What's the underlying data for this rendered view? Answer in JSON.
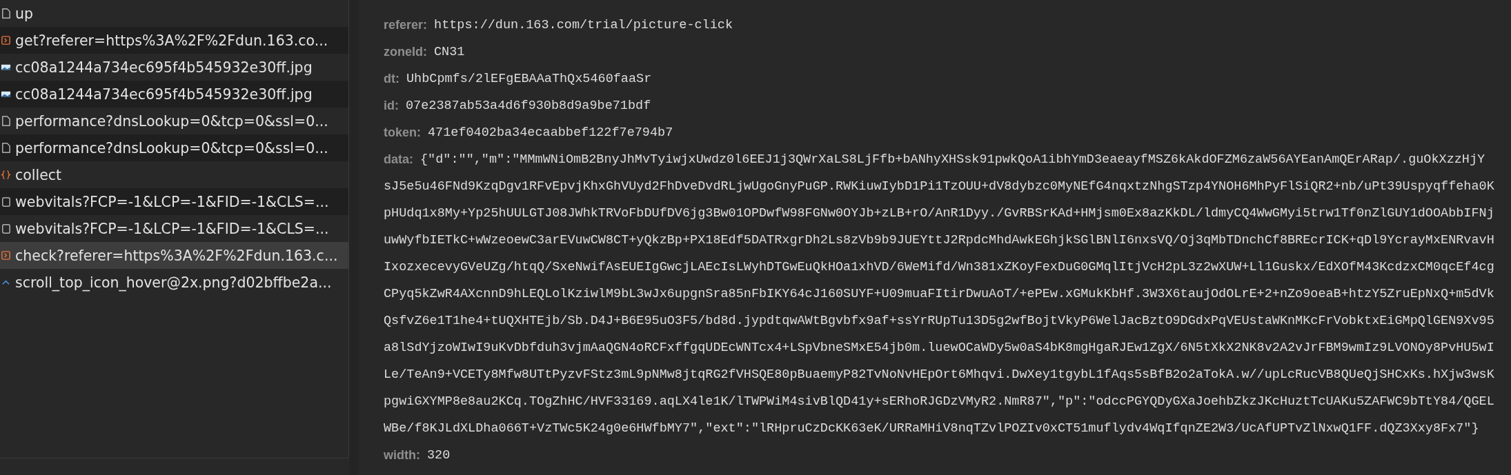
{
  "requests": [
    {
      "name": "up",
      "kind": "document",
      "selected": false
    },
    {
      "name": "get?referer=https%3A%2F%2Fdun.163.co...",
      "kind": "xhr",
      "selected": false
    },
    {
      "name": "cc08a1244a734ec695f4b545932e30ff.jpg",
      "kind": "image",
      "selected": false
    },
    {
      "name": "cc08a1244a734ec695f4b545932e30ff.jpg",
      "kind": "image",
      "selected": false
    },
    {
      "name": "performance?dnsLookup=0&tcp=0&ssl=0...",
      "kind": "document",
      "selected": false
    },
    {
      "name": "performance?dnsLookup=0&tcp=0&ssl=0...",
      "kind": "document",
      "selected": false
    },
    {
      "name": "collect",
      "kind": "fetch",
      "selected": false
    },
    {
      "name": "webvitals?FCP=-1&LCP=-1&FID=-1&CLS=...",
      "kind": "other",
      "selected": false
    },
    {
      "name": "webvitals?FCP=-1&LCP=-1&FID=-1&CLS=...",
      "kind": "other",
      "selected": false
    },
    {
      "name": "check?referer=https%3A%2F%2Fdun.163.c...",
      "kind": "xhr",
      "selected": true
    },
    {
      "name": "scroll_top_icon_hover@2x.png?d02bffbe2a...",
      "kind": "arrow",
      "selected": false
    }
  ],
  "params": [
    {
      "key": "referer:",
      "lines": [
        "https://dun.163.com/trial/picture-click"
      ]
    },
    {
      "key": "zoneId:",
      "lines": [
        "CN31"
      ]
    },
    {
      "key": "dt:",
      "lines": [
        "UhbCpmfs/2lEFgEBAAaThQx5460faaSr"
      ]
    },
    {
      "key": "id:",
      "lines": [
        "07e2387ab53a4d6f930b8d9a9be71bdf"
      ]
    },
    {
      "key": "token:",
      "lines": [
        "471ef0402ba34ecaabbef122f7e794b7"
      ]
    },
    {
      "key": "data:",
      "lines": [
        "{\"d\":\"\",\"m\":\"MMmWNiOmB2BnyJhMvTyiwjxUwdz0l6EEJ1j3QWrXaLS8LjFfb+bANhyXHSsk91pwkQoA1ibhYmD3eaeayfMSZ6kAkdOFZM6zaW56AYEanAmQErARap/.guOkXzzHjY",
        "sJ5e5u46FNd9KzqDgv1RFvEpvjKhxGhVUyd2FhDveDvdRLjwUgoGnyPuGP.RWKiuwIybD1Pi1TzOUU+dV8dybzc0MyNEfG4nqxtzNhgSTzp4YNOH6MhPyFlSiQR2+nb/uPt39Uspyqffeha0K",
        "pHUdq1x8My+Yp25hUULGTJ08JWhkTRVoFbDUfDV6jg3Bw01OPDwfW98FGNw0OYJb+zLB+rO/AnR1Dyy./GvRBSrKAd+HMjsm0Ex8azKkDL/ldmyCQ4WwGMyi5trw1Tf0nZlGUY1dOOAbbIFNj",
        "uwWyfbIETkC+wWzeoewC3arEVuwCW8CT+yQkzBp+PX18Edf5DATRxgrDh2Ls8zVb9b9JUEYttJ2RpdcMhdAwkEGhjkSGlBNlI6nxsVQ/Oj3qMbTDnchCf8BREcrICK+qDl9YcrayMxENRvavH",
        "IxozxecevyGVeUZg/htqQ/SxeNwifAsEUEIgGwcjLAEcIsLWyhDTGwEuQkHOa1xhVD/6WeMifd/Wn381xZKoyFexDuG0GMqlItjVcH2pL3z2wXUW+Ll1Guskx/EdXOfM43KcdzxCM0qcEf4cg",
        "CPyq5kZwR4AXcnnD9hLEQLolKziwlM9bL3wJx6upgnSra85nFbIKY64cJ160SUYF+U09muaFItirDwuAoT/+ePEw.xGMukKbHf.3W3X6taujOdOLrE+2+nZo9oeaB+htzY5ZruEpNxQ+m5dVk",
        "QsfvZ6e1T1he4+tUQXHTEjb/Sb.D4J+B6E95uO3F5/bd8d.jypdtqwAWtBgvbfx9af+ssYrRUpTu13D5g2wfBojtVkyP6WelJacBztO9DGdxPqVEUstaWKnMKcFrVobktxEiGMpQlGEN9Xv95",
        "a8lSdYjzoWIwI9uKvDbfduh3vjmAaQGN4oRCFxffgqUDEcWNTcx4+LSpVbneSMxE54jb0m.luewOCaWDy5w0aS4bK8mgHgaRJEw1ZgX/6N5tXkX2NK8v2A2vJrFBM9wmIz9LVONOy8PvHU5wI",
        "Le/TeAn9+VCETy8Mfw8UTtPyzvFStz3mL9pNMw8jtqRG2fVHSQE80pBuaemyP82TvNoNvHEpOrt6Mhqvi.DwXey1tgybL1fAqs5sBfB2o2aTokA.w//upLcRucVB8QUeQjSHCxKs.hXjw3wsK",
        "pgwiGXYMP8e8au2KCq.TOgZhHC/HVF33169.aqLX4le1K/lTWPWiM4sivBlQD41y+sERhoRJGDzVMyR2.NmR87\",\"p\":\"odccPGYQDyGXaJoehbZkzJKcHuztTcUAKu5ZAFWC9bTtY84/QGEL",
        "WBe/f8KJLdXLDha066T+VzTWc5K24g0e6HWfbMY7\",\"ext\":\"lRHpruCzDcKK63eK/URRaMHiV8nqTZvlPOZIv0xCT51muflydv4WqIfqnZE2W3/UcAfUPTvZlNxwQ1FF.dQZ3Xxy8Fx7\"}"
      ]
    },
    {
      "key": "width:",
      "lines": [
        "320"
      ]
    }
  ]
}
